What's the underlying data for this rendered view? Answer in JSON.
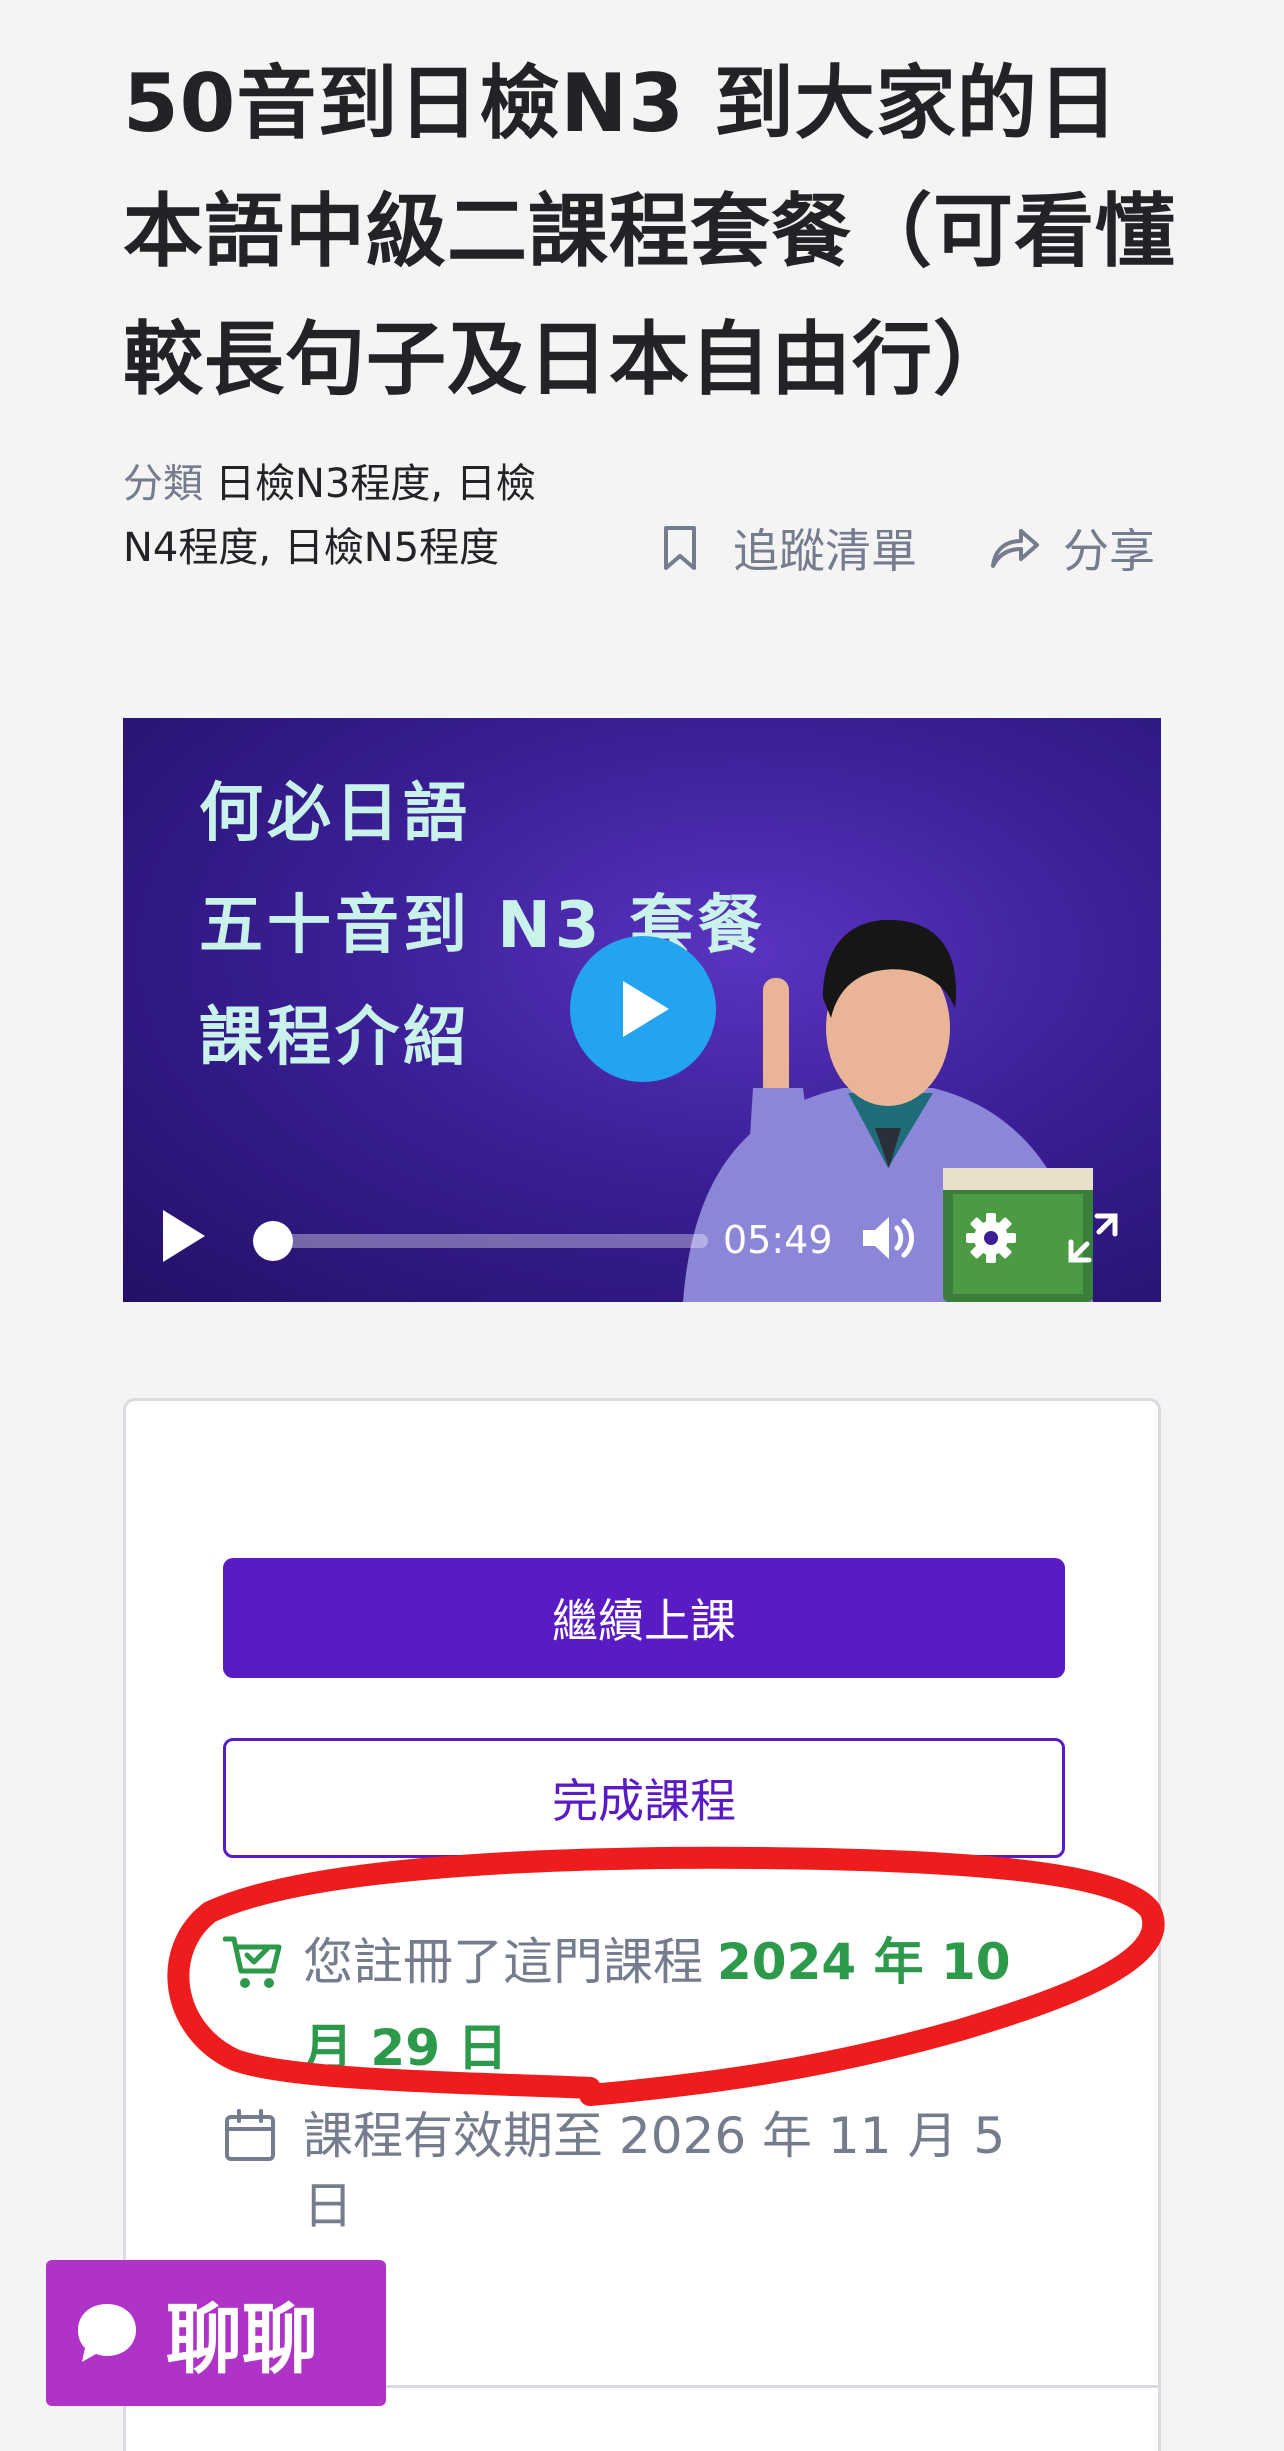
{
  "course": {
    "title": "50音到日檢N3 到大家的日本語中級二課程套餐（可看懂較長句子及日本自由行）",
    "category_label": "分類",
    "categories": [
      "日檢N3程度",
      "日檢N4程度",
      "日檢N5程度"
    ],
    "wishlist_label": "追蹤清單",
    "share_label": "分享"
  },
  "video": {
    "overlay_lines": [
      "何必日語",
      "五十音到 N3 套餐",
      "課程介紹"
    ],
    "duration": "05:49",
    "progress": 0,
    "accent_color": "#22a4f0"
  },
  "enrollment": {
    "continue_label": "繼續上課",
    "complete_label": "完成課程",
    "enrolled_text": "您註冊了這門課程",
    "enrolled_date": "2024 年 10 月 29 日",
    "valid_text": "課程有效期至 2026 年 11 月 5 日",
    "primary_color": "#5b1bc4",
    "date_color": "#2c9a4a"
  },
  "chat": {
    "label": "聊聊",
    "color": "#b033c9"
  },
  "icons": [
    "bookmark-icon",
    "share-icon",
    "play-icon",
    "volume-icon",
    "gear-icon",
    "fullscreen-icon",
    "cart-check-icon",
    "calendar-icon",
    "chat-bubble-icon"
  ]
}
